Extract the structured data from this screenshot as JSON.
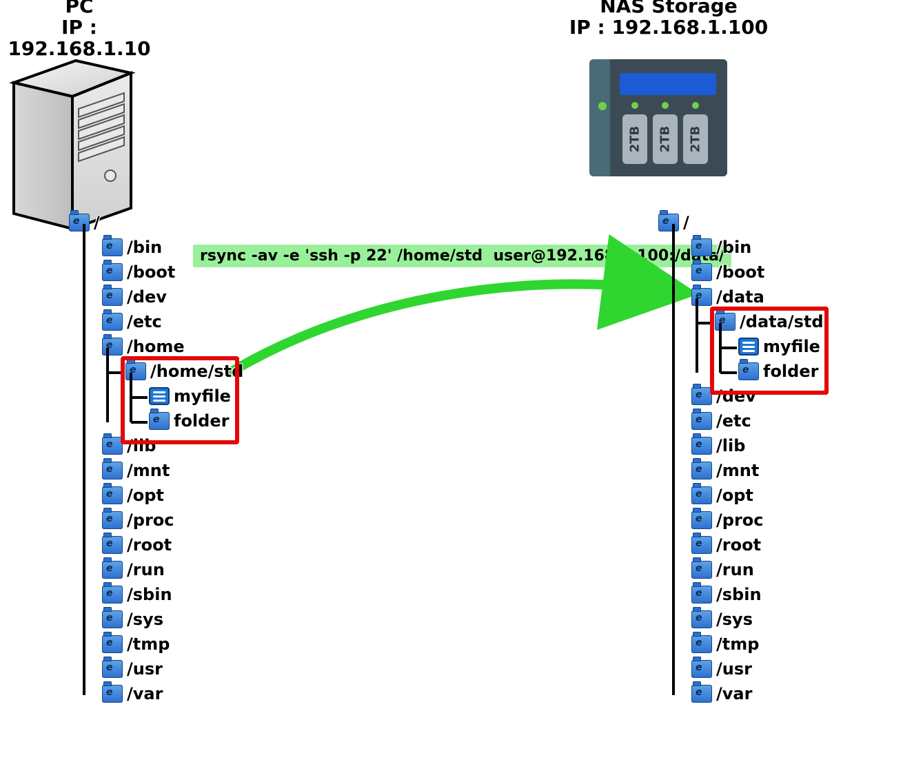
{
  "pc": {
    "title": "PC",
    "ip_label": "IP : 192.168.1.10"
  },
  "nas": {
    "title": "NAS Storage",
    "ip_label": "IP : 192.168.1.100",
    "bay_label": "2TB"
  },
  "command": "rsync -av -e 'ssh -p 22' /home/std  user@192.168.1.100:/data/",
  "tree_left": {
    "root": "/",
    "top": [
      "/bin",
      "/boot",
      "/dev",
      "/etc",
      "/home"
    ],
    "home_sub": {
      "dir": "/home/std",
      "children": [
        {
          "type": "file",
          "name": "myfile"
        },
        {
          "type": "folder",
          "name": "folder"
        }
      ]
    },
    "rest": [
      "/lib",
      "/mnt",
      "/opt",
      "/proc",
      "/root",
      "/run",
      "/sbin",
      "/sys",
      "/tmp",
      "/usr",
      "/var"
    ]
  },
  "tree_right": {
    "root": "/",
    "top": [
      "/bin",
      "/boot",
      "/data"
    ],
    "data_sub": {
      "dir": "/data/std",
      "children": [
        {
          "type": "file",
          "name": "myfile"
        },
        {
          "type": "folder",
          "name": "folder"
        }
      ]
    },
    "rest": [
      "/dev",
      "/etc",
      "/lib",
      "/mnt",
      "/opt",
      "/proc",
      "/root",
      "/run",
      "/sbin",
      "/sys",
      "/tmp",
      "/usr",
      "/var"
    ]
  }
}
